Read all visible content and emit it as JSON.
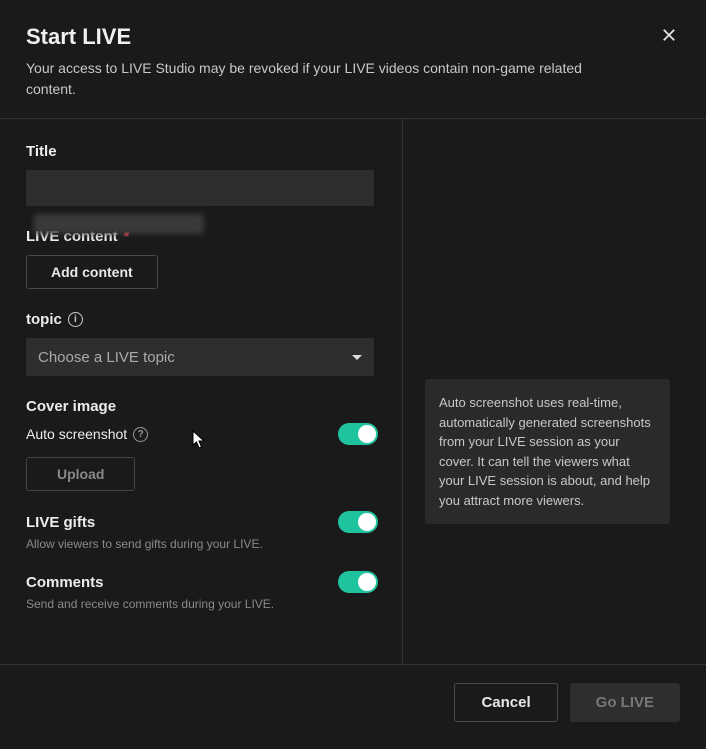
{
  "header": {
    "title": "Start LIVE",
    "subtitle": "Your access to LIVE Studio may be revoked if your LIVE videos contain non-game related content."
  },
  "fields": {
    "title_label": "Title",
    "title_value": "",
    "live_content_label": "LIVE content",
    "add_content_btn": "Add content",
    "topic_label": "topic",
    "topic_placeholder": "Choose a LIVE topic",
    "cover_label": "Cover image",
    "auto_screenshot_label": "Auto screenshot",
    "auto_screenshot_on": true,
    "upload_btn": "Upload",
    "gifts_label": "LIVE gifts",
    "gifts_desc": "Allow viewers to send gifts during your LIVE.",
    "gifts_on": true,
    "comments_label": "Comments",
    "comments_desc": "Send and receive comments during your LIVE.",
    "comments_on": true
  },
  "tooltip": {
    "auto_screenshot": "Auto screenshot uses real-time, automatically generated screenshots from your LIVE session as your cover. It can tell the viewers what your LIVE session is about, and help you attract more viewers."
  },
  "footer": {
    "cancel": "Cancel",
    "go_live": "Go LIVE"
  }
}
